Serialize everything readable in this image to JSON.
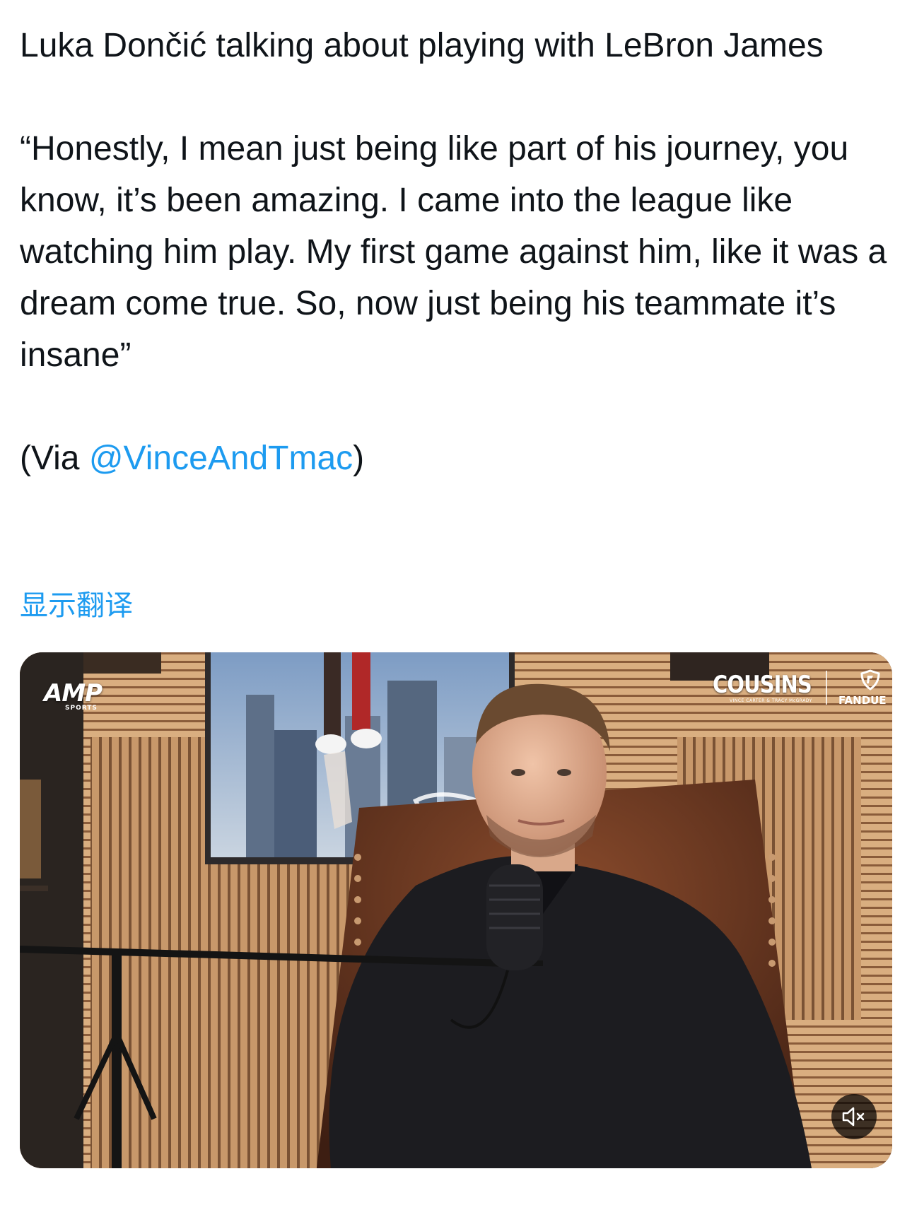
{
  "tweet": {
    "title_line": "Luka Dončić talking about playing with LeBron James",
    "quote": "“Honestly, I mean just being like part of his journey, you know, it’s been amazing. I came into the league like watching him play. My first game against him, like it was a dream come true. So, now just being his teammate it’s insane”",
    "via_prefix": "(Via ",
    "via_mention": "@VinceAndTmac",
    "via_suffix": ")"
  },
  "translate_link": "显示翻译",
  "media": {
    "logo_left": "AMP",
    "logo_left_sub": "SPORTS",
    "logo_right": "COUSINS",
    "logo_right_sub": "VINCE CARTER & TRACY McGRADY",
    "sponsor": "FANDUE",
    "mute_icon": "speaker-muted-icon",
    "colors": {
      "wall": "#b98a5f",
      "slats": "#d7ab7d",
      "shirt": "#1c1c20",
      "chair": "#6b3a23"
    }
  }
}
